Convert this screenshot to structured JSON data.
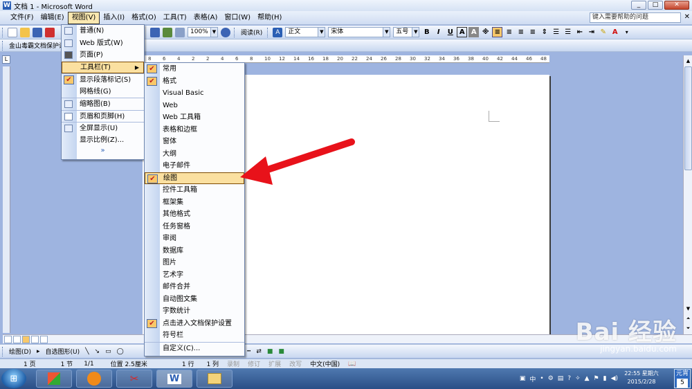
{
  "window": {
    "title": "文档 1 - Microsoft Word",
    "min": "_",
    "max": "□",
    "close": "✕"
  },
  "menubar": {
    "items": [
      "文件(F)",
      "编辑(E)",
      "视图(V)",
      "插入(I)",
      "格式(O)",
      "工具(T)",
      "表格(A)",
      "窗口(W)",
      "帮助(H)"
    ],
    "help_placeholder": "键入需要帮助的问题"
  },
  "toolbar": {
    "zoom": "100%",
    "read_label": "阅读(R)",
    "style": "正文",
    "font": "宋体",
    "size": "五号",
    "bold": "B",
    "italic": "I",
    "underline": "U",
    "char_border": "A",
    "char_shade": "A",
    "ext": "※"
  },
  "toolbar2": {
    "label": "金山毒霸文档保护设"
  },
  "view_menu": {
    "items": [
      {
        "label": "普通(N)"
      },
      {
        "label": "Web 版式(W)"
      },
      {
        "label": "页面(P)"
      },
      {
        "label": "工具栏(T)",
        "submenu": "▶"
      },
      {
        "label": "显示段落标记(S)",
        "check": "✔"
      },
      {
        "label": "网格线(G)"
      },
      {
        "label": "缩略图(B)"
      },
      {
        "label": "页眉和页脚(H)"
      },
      {
        "label": "全屏显示(U)"
      },
      {
        "label": "显示比例(Z)..."
      }
    ],
    "expand": "»"
  },
  "toolbars_menu": {
    "items": [
      {
        "label": "常用",
        "check": "✔"
      },
      {
        "label": "格式",
        "check": "✔"
      },
      {
        "label": "Visual Basic"
      },
      {
        "label": "Web"
      },
      {
        "label": "Web 工具箱"
      },
      {
        "label": "表格和边框"
      },
      {
        "label": "窗体"
      },
      {
        "label": "大纲"
      },
      {
        "label": "电子邮件"
      },
      {
        "label": "绘图",
        "check": "✔"
      },
      {
        "label": "控件工具箱"
      },
      {
        "label": "框架集"
      },
      {
        "label": "其他格式"
      },
      {
        "label": "任务窗格"
      },
      {
        "label": "审阅"
      },
      {
        "label": "数据库"
      },
      {
        "label": "图片"
      },
      {
        "label": "艺术字"
      },
      {
        "label": "邮件合并"
      },
      {
        "label": "自动图文集"
      },
      {
        "label": "字数统计"
      },
      {
        "label": "点击进入文档保护设置",
        "check": "✔"
      },
      {
        "label": "符号栏"
      },
      {
        "label": "自定义(C)..."
      }
    ]
  },
  "ruler": {
    "marks": [
      "8",
      "6",
      "4",
      "2",
      "2",
      "4",
      "6",
      "8",
      "10",
      "12",
      "14",
      "16",
      "18",
      "20",
      "22",
      "24",
      "26",
      "28",
      "30",
      "32",
      "34",
      "36",
      "38",
      "40",
      "42",
      "44",
      "46",
      "48"
    ],
    "corner": "L"
  },
  "drawbar": {
    "draw": "绘图(D)",
    "autoshapes": "自选图形(U)"
  },
  "statusbar": {
    "page": "1 页",
    "section": "1 节",
    "pages": "1/1",
    "position": "位置 2.5厘米",
    "line": "1 行",
    "column": "1 列",
    "rec": "录制",
    "trk": "修订",
    "ext": "扩展",
    "ovr": "改写",
    "lang": "中文(中国)"
  },
  "taskbar": {
    "start": "⊞",
    "word_label": "W",
    "ime": "中",
    "time": "22:55 星期六",
    "date": "2015/2/28",
    "ime_box_top": "元宵",
    "ime_box_bottom": "5"
  },
  "watermark": {
    "brand": "Bai 经验",
    "url": "jingyan.baidu.com"
  },
  "colors": {
    "highlight": "#fbe0a0",
    "check_bg": "#f8c86a",
    "arrow": "#e8121a"
  }
}
